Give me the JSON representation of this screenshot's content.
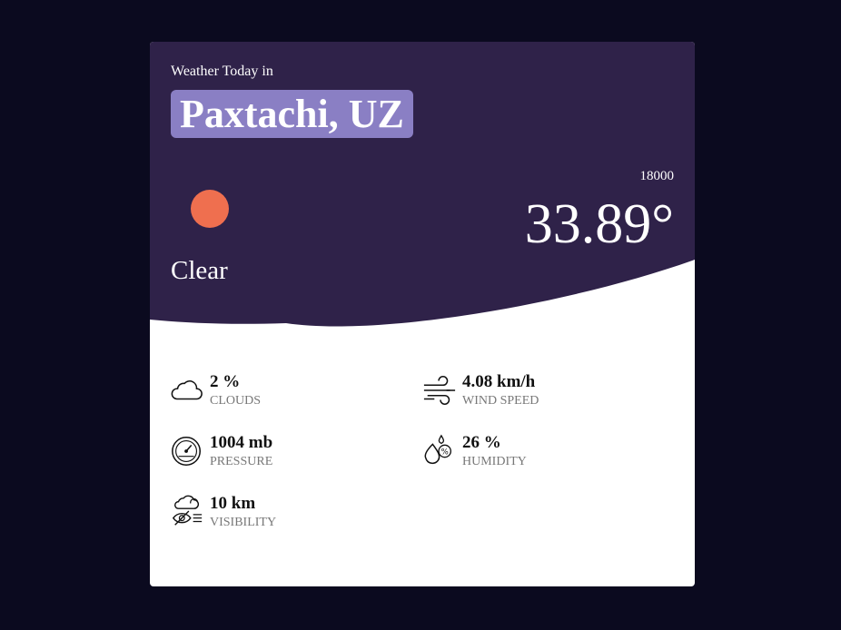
{
  "header": {
    "label": "Weather Today in",
    "city": "Paxtachi, UZ"
  },
  "current": {
    "condition": "Clear",
    "small_value": "18000",
    "temperature": "33.89°",
    "sun_icon": "sun-icon"
  },
  "stats": [
    {
      "value": "2 %",
      "label": "Clouds",
      "icon": "cloud-icon"
    },
    {
      "value": "4.08 km/h",
      "label": "Wind Speed",
      "icon": "wind-icon"
    },
    {
      "value": "1004 mb",
      "label": "Pressure",
      "icon": "gauge-icon"
    },
    {
      "value": "26 %",
      "label": "Humidity",
      "icon": "humidity-icon"
    },
    {
      "value": "10 km",
      "label": "Visibility",
      "icon": "visibility-icon"
    }
  ],
  "colors": {
    "page_bg": "#0b0a1f",
    "header_bg": "#2f2249",
    "city_badge": "#8a7fc4",
    "sun": "#ef6f4f"
  }
}
